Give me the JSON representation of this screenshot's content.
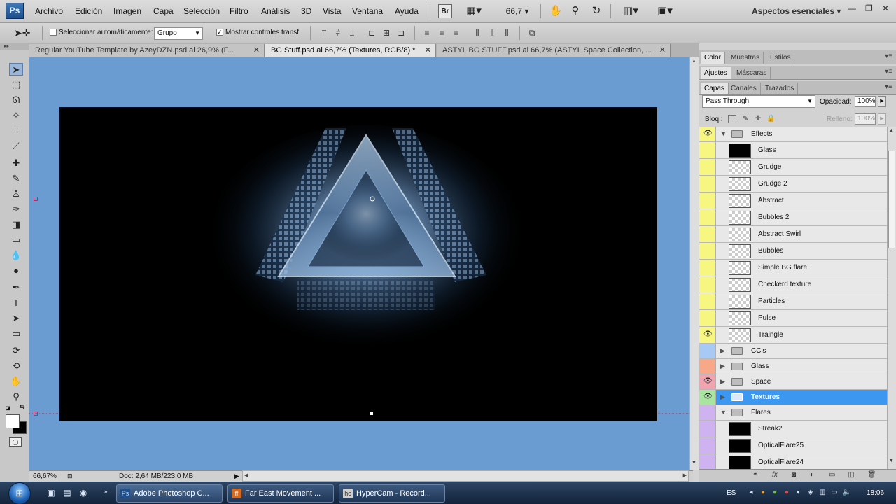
{
  "menubar": {
    "logo": "Ps",
    "items": [
      "Archivo",
      "Edición",
      "Imagen",
      "Capa",
      "Selección",
      "Filtro",
      "Análisis",
      "3D",
      "Vista",
      "Ventana",
      "Ayuda"
    ],
    "bridge_label": "Br",
    "zoom": "66,7",
    "workspace": "Aspectos esenciales",
    "icons": [
      "bridge-icon",
      "guides-icon",
      "hand-icon",
      "zoom-icon",
      "rotate-icon",
      "arrange-icon",
      "screen-mode-icon"
    ]
  },
  "options": {
    "auto_select_label": "Seleccionar automáticamente:",
    "auto_select_checked": false,
    "group_value": "Grupo",
    "show_transform_label": "Mostrar controles transf.",
    "show_transform_checked": true
  },
  "tabs": [
    {
      "label": "Regular YouTube Template by AzeyDZN.psd al 26,9% (F...",
      "active": false
    },
    {
      "label": "BG Stuff.psd al 66,7% (Textures, RGB/8) *",
      "active": true
    },
    {
      "label": "ASTYL BG STUFF.psd al 66,7% (ASTYL Space Collection, ...",
      "active": false
    }
  ],
  "status": {
    "zoom": "66,67%",
    "doc": "Doc: 2,64 MB/223,0 MB"
  },
  "panels": {
    "top_tabs": [
      "Color",
      "Muestras",
      "Estilos"
    ],
    "adj_tabs": [
      "Ajustes",
      "Máscaras"
    ],
    "layer_tabs": [
      "Capas",
      "Canales",
      "Trazados"
    ],
    "blend_mode": "Pass Through",
    "opacity_label": "Opacidad:",
    "opacity_value": "100%",
    "lock_label": "Bloq.:",
    "fill_label": "Relleno:",
    "fill_value": "100%"
  },
  "layers": [
    {
      "name": "Effects",
      "type": "group",
      "expanded": true,
      "visible": true,
      "color": "#f6f680"
    },
    {
      "name": "Glass",
      "type": "layer",
      "thumb": "dark",
      "visible": false,
      "color": "#f6f680"
    },
    {
      "name": "Grudge",
      "type": "layer",
      "thumb": "checker",
      "visible": false,
      "color": "#f6f680"
    },
    {
      "name": "Grudge 2",
      "type": "layer",
      "thumb": "checker",
      "visible": false,
      "color": "#f6f680"
    },
    {
      "name": "Abstract",
      "type": "layer",
      "thumb": "checker",
      "visible": false,
      "color": "#f6f680"
    },
    {
      "name": "Bubbles 2",
      "type": "layer",
      "thumb": "checker",
      "visible": false,
      "color": "#f6f680"
    },
    {
      "name": "Abstract Swirl",
      "type": "layer",
      "thumb": "checker",
      "visible": false,
      "color": "#f6f680"
    },
    {
      "name": "Bubbles",
      "type": "layer",
      "thumb": "checker",
      "visible": false,
      "color": "#f6f680"
    },
    {
      "name": "Simple BG flare",
      "type": "layer",
      "thumb": "checker",
      "visible": false,
      "color": "#f6f680"
    },
    {
      "name": "Checkerd texture",
      "type": "layer",
      "thumb": "checker",
      "visible": false,
      "color": "#f6f680"
    },
    {
      "name": "Particles",
      "type": "layer",
      "thumb": "checker",
      "visible": false,
      "color": "#f6f680"
    },
    {
      "name": "Pulse",
      "type": "layer",
      "thumb": "checker",
      "visible": false,
      "color": "#f6f680"
    },
    {
      "name": "Traingle",
      "type": "layer",
      "thumb": "checker",
      "visible": true,
      "color": "#f6f680"
    },
    {
      "name": "CC's",
      "type": "group",
      "expanded": false,
      "visible": false,
      "color": "#a9c9f5"
    },
    {
      "name": "Glass",
      "type": "group",
      "expanded": false,
      "visible": false,
      "color": "#f6a889"
    },
    {
      "name": "Space",
      "type": "group",
      "expanded": false,
      "visible": true,
      "color": "#f1a3b0"
    },
    {
      "name": "Textures",
      "type": "group",
      "expanded": false,
      "visible": true,
      "selected": true,
      "color": "#a8e6a0"
    },
    {
      "name": "Flares",
      "type": "group",
      "expanded": true,
      "visible": false,
      "color": "#cfb2f0"
    },
    {
      "name": "Streak2",
      "type": "layer",
      "thumb": "dark",
      "visible": false,
      "color": "#cfb2f0"
    },
    {
      "name": "OpticalFlare25",
      "type": "layer",
      "thumb": "dark",
      "visible": false,
      "color": "#cfb2f0"
    },
    {
      "name": "OpticalFlare24",
      "type": "layer",
      "thumb": "dark",
      "visible": false,
      "color": "#cfb2f0"
    }
  ],
  "taskbar": {
    "buttons": [
      {
        "label": "Adobe Photoshop C...",
        "icon": "Ps",
        "active": true
      },
      {
        "label": "Far East Movement ...",
        "icon": "ff",
        "active": false
      },
      {
        "label": "HyperCam - Record...",
        "icon": "hc",
        "active": false
      }
    ],
    "lang": "ES",
    "clock": "18:06"
  },
  "colors": {
    "canvas_bg": "#6a9bd1",
    "selection": "#3c97f0"
  }
}
